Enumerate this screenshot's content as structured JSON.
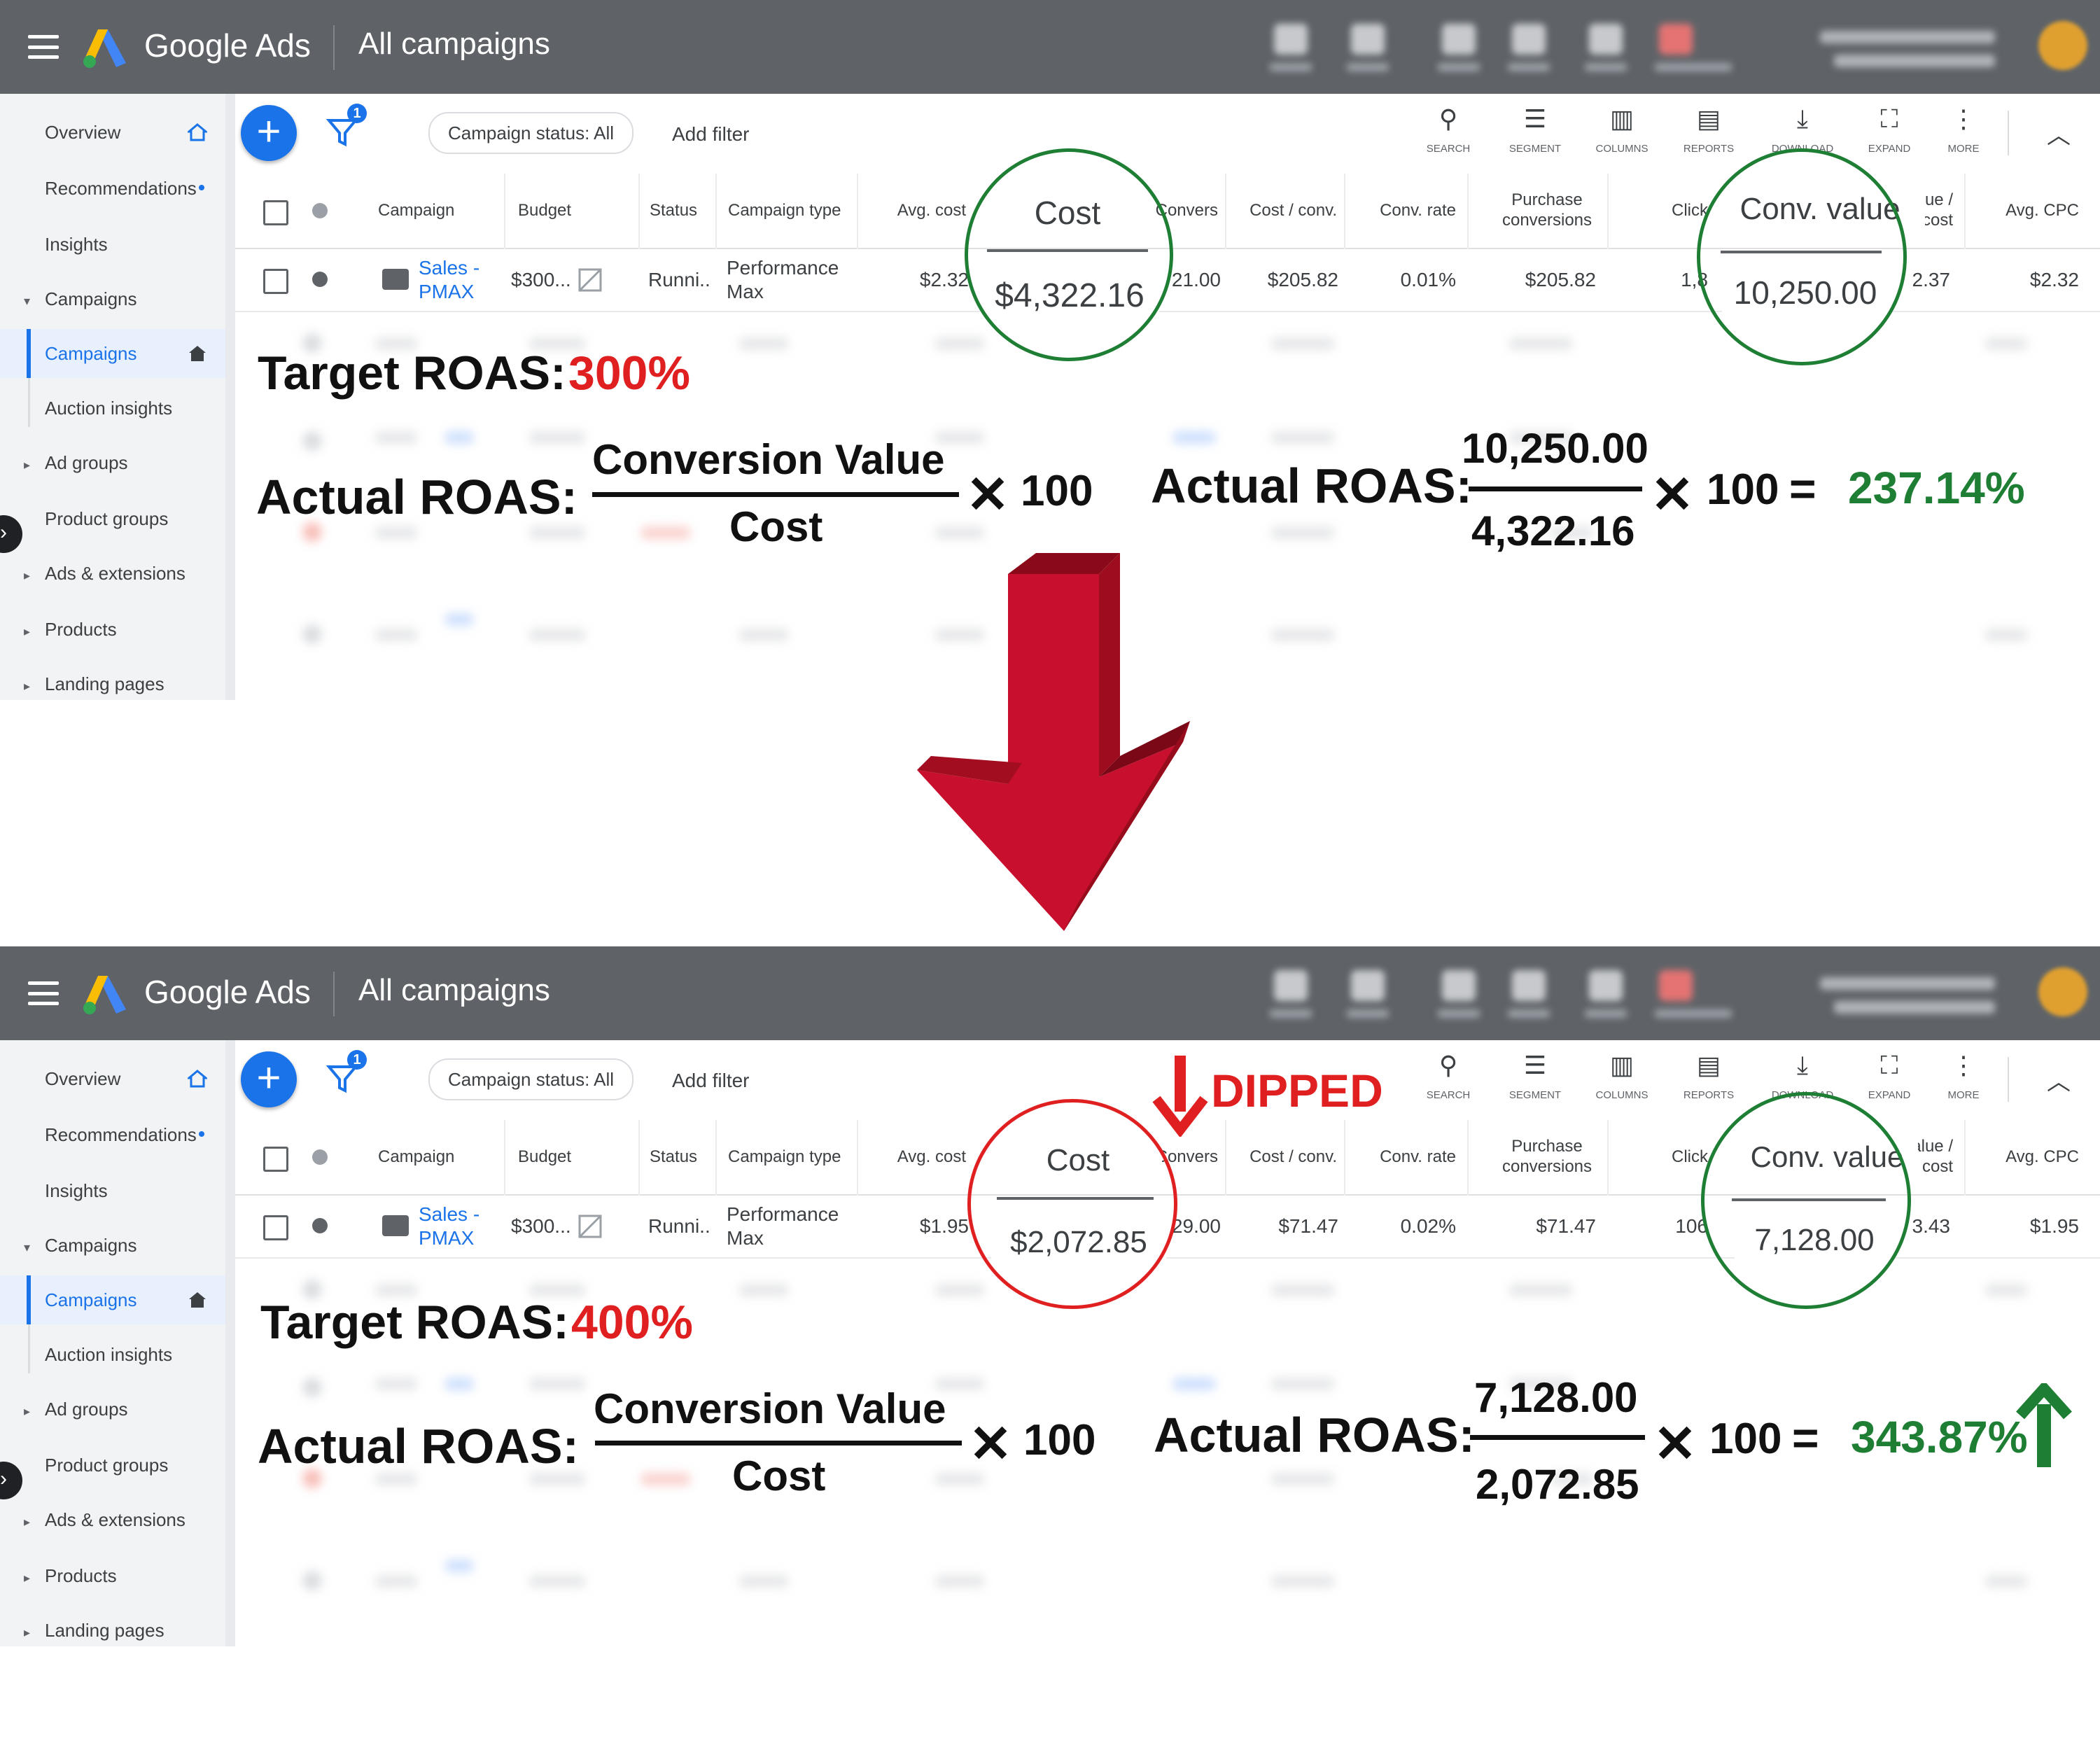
{
  "app": {
    "brand": "Google Ads",
    "page_title": "All campaigns"
  },
  "sidebar": {
    "items": [
      {
        "label": "Overview"
      },
      {
        "label": "Recommendations"
      },
      {
        "label": "Insights"
      },
      {
        "label": "Campaigns"
      },
      {
        "label": "Campaigns"
      },
      {
        "label": "Auction insights"
      },
      {
        "label": "Ad groups"
      },
      {
        "label": "Product groups"
      },
      {
        "label": "Ads & extensions"
      },
      {
        "label": "Products"
      },
      {
        "label": "Landing pages"
      }
    ]
  },
  "filterbar": {
    "filter_badge": "1",
    "chip": "Campaign status: All",
    "add_filter": "Add filter",
    "tools": [
      "SEARCH",
      "SEGMENT",
      "COLUMNS",
      "REPORTS",
      "DOWNLOAD",
      "EXPAND",
      "MORE"
    ]
  },
  "table": {
    "headers": {
      "campaign": "Campaign",
      "budget": "Budget",
      "status": "Status",
      "campaign_type": "Campaign type",
      "avg_cost": "Avg. cost",
      "cost": "Cost",
      "conversions": "Convers",
      "cost_per_conv": "Cost / conv.",
      "conv_rate": "Conv. rate",
      "purchase_conv": "Purchase conversions",
      "clicks": "Click",
      "conv_value": "Conv. value",
      "value_per_cost": "value / cost",
      "avg_cpc": "Avg. CPC"
    }
  },
  "panels": [
    {
      "row": {
        "campaign_name": "Sales - PMAX",
        "budget": "$300...",
        "status": "Runni..",
        "campaign_type": "Performance Max",
        "avg_cost": "$2.32",
        "cost": "$4,322.16",
        "conversions": "21.00",
        "cost_per_conv": "$205.82",
        "conv_rate": "0.01%",
        "purchase_conv": "$205.82",
        "clicks": "1,8",
        "conv_value": "10,250.00",
        "value_per_cost": "2.37",
        "avg_cpc": "$2.32"
      },
      "target_label": "Target ROAS:",
      "target_value": "300%",
      "formula": {
        "label": "Actual ROAS:",
        "numerator": "Conversion Value",
        "denominator": "Cost",
        "times": "100"
      },
      "calc": {
        "label": "Actual ROAS:",
        "numerator": "10,250.00",
        "denominator": "4,322.16",
        "times": "100",
        "result": "237.14%"
      }
    },
    {
      "row": {
        "campaign_name": "Sales - PMAX",
        "budget": "$300...",
        "status": "Runni..",
        "campaign_type": "Performance Max",
        "avg_cost": "$1.95",
        "cost": "$2,072.85",
        "conversions": "29.00",
        "cost_per_conv": "$71.47",
        "conv_rate": "0.02%",
        "purchase_conv": "$71.47",
        "clicks": "106",
        "conv_value": "7,128.00",
        "value_per_cost": "3.43",
        "avg_cpc": "$1.95"
      },
      "target_label": "Target ROAS:",
      "target_value": "400%",
      "formula": {
        "label": "Actual ROAS:",
        "numerator": "Conversion Value",
        "denominator": "Cost",
        "times": "100"
      },
      "calc": {
        "label": "Actual ROAS:",
        "numerator": "7,128.00",
        "denominator": "2,072.85",
        "times": "100",
        "result": "343.87%"
      },
      "callout": "DIPPED"
    }
  ],
  "colors": {
    "topbar": "#5f6368",
    "accent": "#1a73e8",
    "highlight_red": "#e02020",
    "highlight_green": "#1e7e34",
    "arrow": "#c8102e"
  }
}
